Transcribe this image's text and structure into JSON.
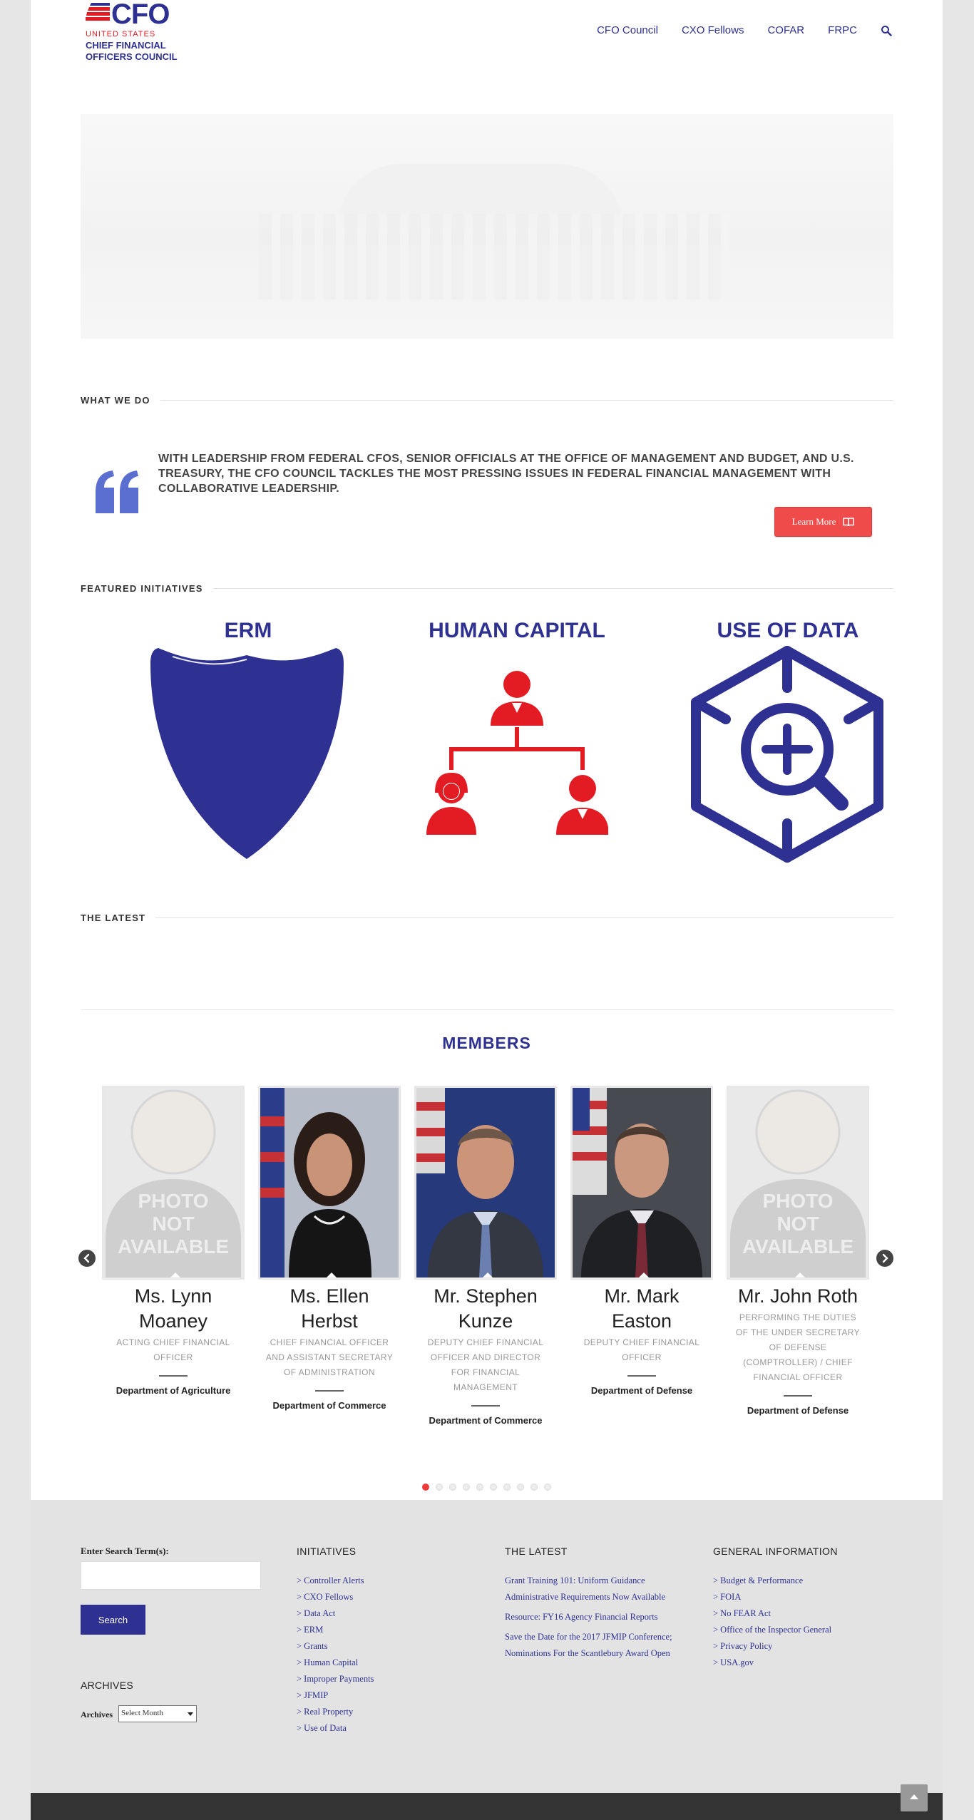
{
  "logo": {
    "acronym": "CFO",
    "line1": "UNITED STATES",
    "line2": "CHIEF FINANCIAL OFFICERS COUNCIL"
  },
  "nav": {
    "items": [
      "CFO Council",
      "CXO Fellows",
      "COFAR",
      "FRPC"
    ],
    "search_icon": "search-icon"
  },
  "sections": {
    "what_we_do": "WHAT WE DO",
    "featured": "FEATURED INITIATIVES",
    "latest": "THE LATEST"
  },
  "what_we_do": {
    "quote": "WITH LEADERSHIP FROM FEDERAL CFOS, SENIOR OFFICIALS AT THE OFFICE OF MANAGEMENT AND BUDGET, AND U.S. TREASURY, THE CFO COUNCIL TACKLES THE MOST PRESSING ISSUES IN FEDERAL FINANCIAL MANAGEMENT WITH COLLABORATIVE LEADERSHIP.",
    "button": "Learn More"
  },
  "initiatives": [
    {
      "title": "ERM",
      "icon": "shield-icon"
    },
    {
      "title": "HUMAN CAPITAL",
      "icon": "org-chart-icon"
    },
    {
      "title": "USE OF DATA",
      "icon": "data-search-icon"
    }
  ],
  "members": {
    "heading": "MEMBERS",
    "placeholder_text": [
      "PHOTO",
      "NOT",
      "AVAILABLE"
    ],
    "list": [
      {
        "name": "Ms. Lynn Moaney",
        "title": "ACTING CHIEF FINANCIAL OFFICER",
        "dept": "Department of Agriculture"
      },
      {
        "name": "Ms. Ellen Herbst",
        "title": "CHIEF FINANCIAL OFFICER AND ASSISTANT SECRETARY OF ADMINISTRATION",
        "dept": "Department of Commerce"
      },
      {
        "name": "Mr. Stephen Kunze",
        "title": "DEPUTY CHIEF FINANCIAL OFFICER AND DIRECTOR FOR FINANCIAL MANAGEMENT",
        "dept": "Department of Commerce"
      },
      {
        "name": "Mr. Mark Easton",
        "title": "DEPUTY CHIEF FINANCIAL OFFICER",
        "dept": "Department of Defense"
      },
      {
        "name": "Mr. John Roth",
        "title": "PERFORMING THE DUTIES OF THE UNDER SECRETARY OF DEFENSE (COMPTROLLER) / CHIEF FINANCIAL OFFICER",
        "dept": "Department of Defense"
      }
    ],
    "pages": 10,
    "active_page": 1
  },
  "footer": {
    "search_label": "Enter Search Term(s):",
    "search_button": "Search",
    "archives_heading": "ARCHIVES",
    "archives_label": "Archives",
    "archives_select": "Select Month",
    "initiatives_heading": "INITIATIVES",
    "initiatives": [
      "> Controller Alerts",
      "> CXO Fellows",
      "> Data Act",
      "> ERM",
      "> Grants",
      "> Human Capital",
      "> Improper Payments",
      "> JFMIP",
      "> Real Property",
      "> Use of Data"
    ],
    "latest_heading": "THE LATEST",
    "latest": [
      "Grant Training 101: Uniform Guidance Administrative Requirements Now Available",
      "Resource: FY16 Agency Financial Reports",
      "Save the Date for the 2017 JFMIP Conference; Nominations For the Scantlebury Award Open"
    ],
    "general_heading": "GENERAL INFORMATION",
    "general": [
      "> Budget & Performance",
      "> FOIA",
      "> No FEAR Act",
      "> Office of the Inspector General",
      "> Privacy Policy",
      "> USA.gov"
    ]
  },
  "colors": {
    "brand_blue": "#2e3192",
    "brand_red": "#e31b23",
    "button_red": "#ef4b4b",
    "quote_blue": "#5a6fd0"
  }
}
